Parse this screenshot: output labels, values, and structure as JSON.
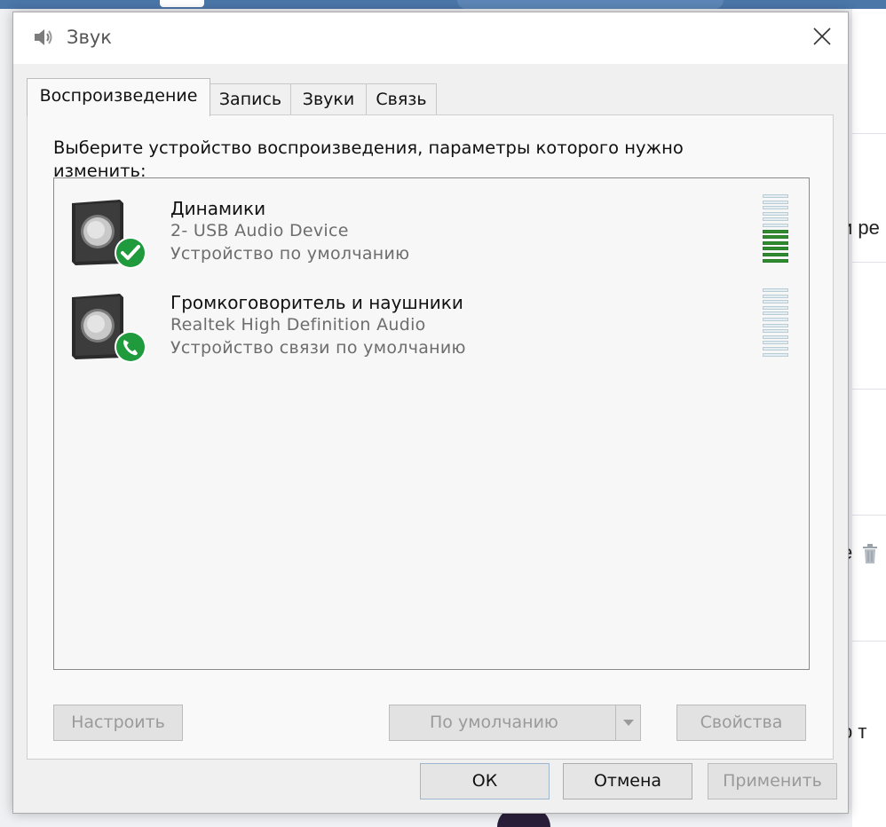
{
  "window": {
    "title": "Звук",
    "close_label": "×"
  },
  "tabs": [
    {
      "label": "Воспроизведение",
      "active": true
    },
    {
      "label": "Запись",
      "active": false
    },
    {
      "label": "Звуки",
      "active": false
    },
    {
      "label": "Связь",
      "active": false
    }
  ],
  "panel": {
    "instructions_line1": "Выберите устройство воспроизведения, параметры которого нужно",
    "instructions_line2": "изменить:"
  },
  "devices": [
    {
      "name": "Динамики",
      "description": "2- USB Audio Device",
      "status": "Устройство по умолчанию",
      "badge_icon": "checkmark-icon",
      "level_segments_total": 12,
      "level_segments_active": 6
    },
    {
      "name": "Громкоговоритель и наушники",
      "description": "Realtek High Definition Audio",
      "status": "Устройство связи по умолчанию",
      "badge_icon": "phone-icon",
      "level_segments_total": 12,
      "level_segments_active": 0
    }
  ],
  "buttons": {
    "configure": "Настроить",
    "set_default": "По умолчанию",
    "properties": "Свойства",
    "ok": "ОК",
    "cancel": "Отмена",
    "apply": "Применить"
  },
  "background": {
    "text_fragment_1": "и ре",
    "text_fragment_2": "о т",
    "text_fragment_3": "е"
  },
  "colors": {
    "accent_green": "#2e8b2e",
    "meter_idle": "#e4eef2",
    "disabled_text": "#9a9a9a",
    "topbar_blue": "#4a76a8"
  }
}
